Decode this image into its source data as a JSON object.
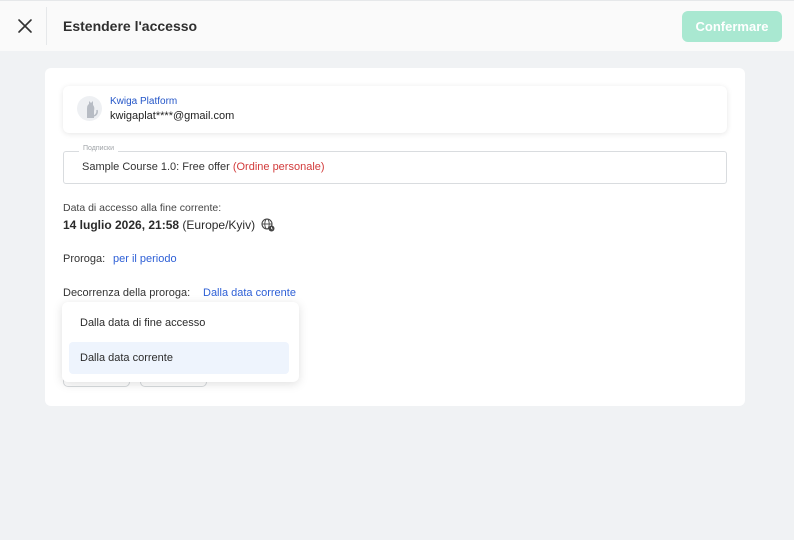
{
  "header": {
    "title": "Estendere l'accesso",
    "confirm_label": "Confermare"
  },
  "user": {
    "name": "Kwiga Platform",
    "email": "kwigaplat****@gmail.com"
  },
  "subscription": {
    "legend": "Подписки",
    "course": "Sample Course 1.0: Free offer",
    "order_label": "(Ordine personale)"
  },
  "access": {
    "label": "Data di accesso alla fine corrente:",
    "date": "14 luglio 2026, 21:58",
    "timezone": "(Europe/Kyiv)"
  },
  "extension": {
    "label": "Proroga:",
    "value": "per il periodo"
  },
  "start": {
    "label": "Decorrenza della proroga:",
    "value": "Dalla data corrente"
  },
  "dropdown": {
    "options": [
      "Dalla data di fine accesso",
      "Dalla data corrente"
    ],
    "selected_index": 1
  },
  "colors": {
    "accent": "#2d5fd6",
    "confirm_disabled": "#a9e8d1",
    "order_red": "#d23b3b"
  }
}
